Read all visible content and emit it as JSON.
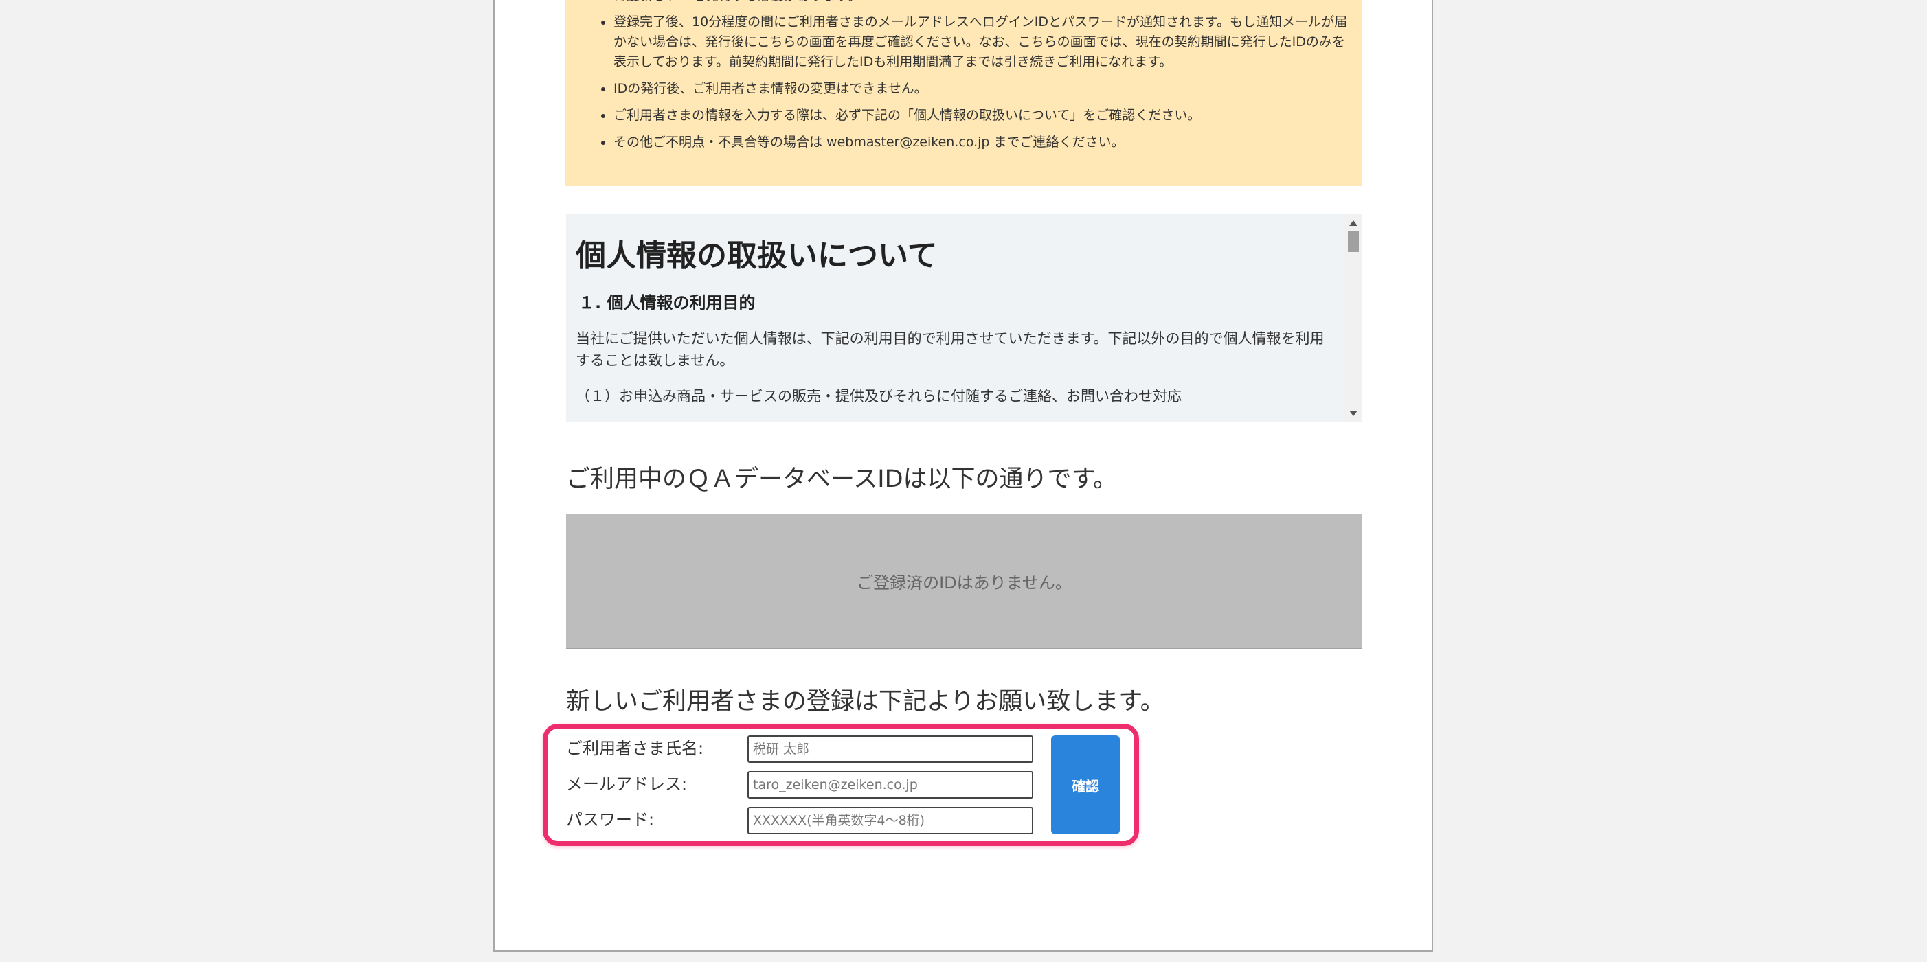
{
  "notice": {
    "items": [
      "再度新しいIDを発行する必要があります。",
      "登録完了後、10分程度の間にご利用者さまのメールアドレスへログインIDとパスワードが通知されます。もし通知メールが届かない場合は、発行後にこちらの画面を再度ご確認ください。なお、こちらの画面では、現在の契約期間に発行したIDのみを表示しております。前契約期間に発行したIDも利用期間満了までは引き続きご利用になれます。",
      "IDの発行後、ご利用者さま情報の変更はできません。",
      "ご利用者さまの情報を入力する際は、必ず下記の「個人情報の取扱いについて」をご確認ください。",
      "その他ご不明点・不具合等の場合は webmaster@zeiken.co.jp までご連絡ください。"
    ]
  },
  "privacy": {
    "title": "個人情報の取扱いについて",
    "section1_title": "１. 個人情報の利用目的",
    "paragraph": "当社にご提供いただいた個人情報は、下記の利用目的で利用させていただきます。下記以外の目的で個人情報を利用することは致しません。",
    "item1": "（１）お申込み商品・サービスの販売・提供及びそれらに付随するご連絡、お問い合わせ対応"
  },
  "current_ids": {
    "heading": "ご利用中のＱＡデータベースIDは以下の通りです。",
    "empty_message": "ご登録済のIDはありません。"
  },
  "new_user": {
    "heading": "新しいご利用者さまの登録は下記よりお願い致します。",
    "name_label": "ご利用者さま氏名:",
    "name_placeholder": "税研 太郎",
    "email_label": "メールアドレス:",
    "email_placeholder": "taro_zeiken@zeiken.co.jp",
    "password_label": "パスワード:",
    "password_placeholder": "XXXXXX(半角英数字4～8桁)",
    "confirm_label": "確認"
  },
  "colors": {
    "notice_bg": "#ffe8b5",
    "privacy_bg": "#eff3f6",
    "id_box_bg": "#bdbdbd",
    "highlight": "#ee2d6c",
    "confirm_button": "#2b84dc"
  }
}
